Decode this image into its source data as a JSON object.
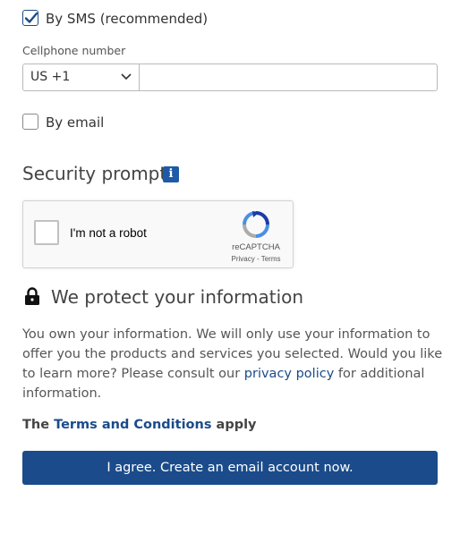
{
  "contact": {
    "sms_label": "By SMS (recommended)",
    "sms_checked": true,
    "phone_label": "Cellphone number",
    "country_code": "US +1",
    "phone_value": "",
    "email_label": "By email",
    "email_checked": false
  },
  "security": {
    "title": "Security prompt",
    "info_icon": "info-icon",
    "captcha_label": "I'm not a robot",
    "captcha_brand": "reCAPTCHA",
    "captcha_privacy": "Privacy",
    "captcha_sep": " - ",
    "captcha_terms": "Terms"
  },
  "privacy": {
    "title": "We protect your information",
    "lock_icon": "lock-icon",
    "para_before": "You own your information. We will only use your information to offer you the products and services you selected. Would you like to learn more? Please consult our ",
    "policy_link": "privacy policy",
    "para_after": " for additional information."
  },
  "terms": {
    "before": "The ",
    "link": "Terms and Conditions",
    "after": " apply"
  },
  "cta": {
    "label": "I agree. Create an email account now."
  },
  "colors": {
    "accent": "#1b4b8a",
    "info": "#1e5aa8"
  }
}
